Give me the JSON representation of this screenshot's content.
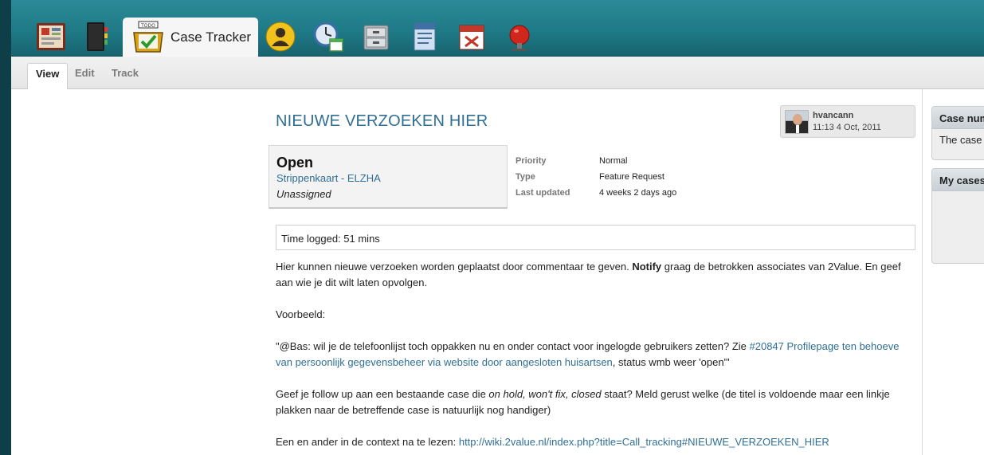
{
  "apps": {
    "active_label": "Case Tracker",
    "icons": [
      "dashboard-icon",
      "notebook-icon",
      "todo-icon",
      "user-icon",
      "clock-calendar-icon",
      "filing-cabinet-icon",
      "support-icon",
      "calendar-icon",
      "alarm-bell-icon"
    ]
  },
  "subtabs": [
    "View",
    "Edit",
    "Track"
  ],
  "case": {
    "title": "NIEUWE VERZOEKEN HIER",
    "author": "hvancann",
    "timestamp": "11:13 4 Oct, 2011",
    "status": "Open",
    "project": "Strippenkaart - ELZHA",
    "assignee": "Unassigned",
    "priority_label": "Priority",
    "priority": "Normal",
    "type_label": "Type",
    "type": "Feature Request",
    "updated_label": "Last updated",
    "updated": "4 weeks 2 days ago",
    "time_logged": "Time logged: 51 mins"
  },
  "body": {
    "p1_a": "Hier kunnen nieuwe verzoeken worden geplaatst door commentaar te geven. ",
    "p1_bold": "Notify",
    "p1_b": " graag de betrokken associates van 2Value. En geef aan wie je dit wilt laten opvolgen.",
    "p2": "Voorbeeld:",
    "p3_a": "\"@Bas: wil je de telefoonlijst toch oppakken nu en onder contact voor ingelogde gebruikers zetten? Zie ",
    "p3_link": "#20847 Profilepage ten behoeve van persoonlijk gegevensbeheer via website door aangesloten huisartsen",
    "p3_b": ", status wmb weer 'open'\"",
    "p4_a": "Geef je follow up aan een bestaande case die ",
    "p4_italic": "on hold, won't fix, closed",
    "p4_b": " staat? Meld gerust welke (de titel is voldoende maar een linkje plakken naar de betreffende case is natuurlijk nog handiger)",
    "p5_a": "Een en ander in de context na te lezen: ",
    "p5_link": "http://wiki.2value.nl/index.php?title=Call_tracking#NIEUWE_VERZOEKEN_HIER"
  },
  "sidebar": {
    "block1_title": "Case num",
    "block1_text": "The case",
    "block2_title": "My cases"
  }
}
